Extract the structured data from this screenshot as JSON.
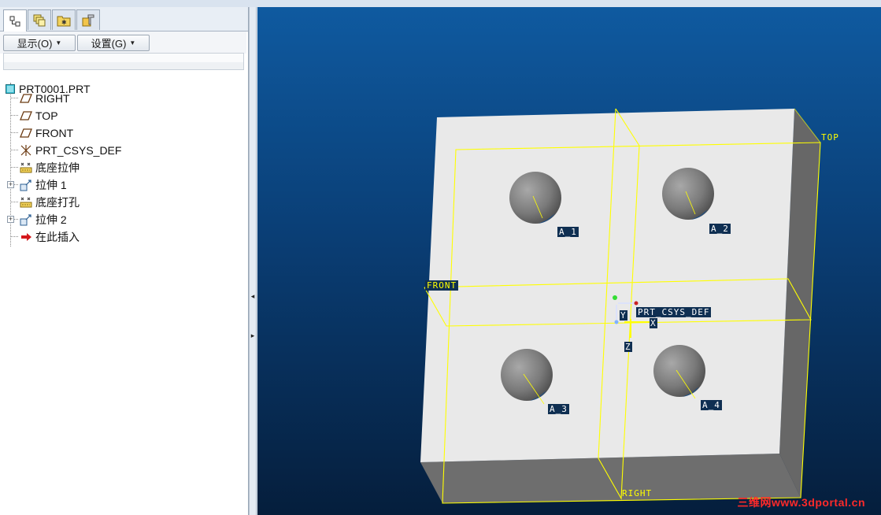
{
  "tabs": [
    {
      "name": "model-tree-icon",
      "active": true
    },
    {
      "name": "layers-icon",
      "active": false
    },
    {
      "name": "favorites-folder-icon",
      "active": false
    },
    {
      "name": "tools-icon",
      "active": false
    }
  ],
  "toolbar": {
    "display_label": "显示(O)",
    "settings_label": "设置(G)"
  },
  "tree": {
    "root": "PRT0001.PRT",
    "items": [
      {
        "label": "RIGHT",
        "icon": "datum-plane-icon"
      },
      {
        "label": "TOP",
        "icon": "datum-plane-icon"
      },
      {
        "label": "FRONT",
        "icon": "datum-plane-icon"
      },
      {
        "label": "PRT_CSYS_DEF",
        "icon": "coordinate-system-icon"
      },
      {
        "label": "底座拉伸",
        "icon": "sketch-feature-icon"
      },
      {
        "label": "拉伸 1",
        "icon": "extrude-icon",
        "expandable": true
      },
      {
        "label": "底座打孔",
        "icon": "sketch-feature-icon"
      },
      {
        "label": "拉伸 2",
        "icon": "extrude-icon",
        "expandable": true
      },
      {
        "label": "在此插入",
        "icon": "insert-here-arrow-icon"
      }
    ]
  },
  "viewport": {
    "plane_labels": {
      "top": "TOP",
      "front": "FRONT",
      "right": "RIGHT"
    },
    "axis_labels": [
      "A_1",
      "A_2",
      "A_3",
      "A_4"
    ],
    "csys_label": "PRT_CSYS_DEF",
    "csys_axes": {
      "x": "X",
      "y": "Y",
      "z": "Z"
    },
    "watermark": "三维网www.3dportal.cn"
  },
  "colors": {
    "datum_yellow": "#ffff00",
    "part_face": "#e9e9e9",
    "part_side": "#6a6a6a",
    "background_top": "#0f5aa0",
    "background_bottom": "#051e3c"
  }
}
